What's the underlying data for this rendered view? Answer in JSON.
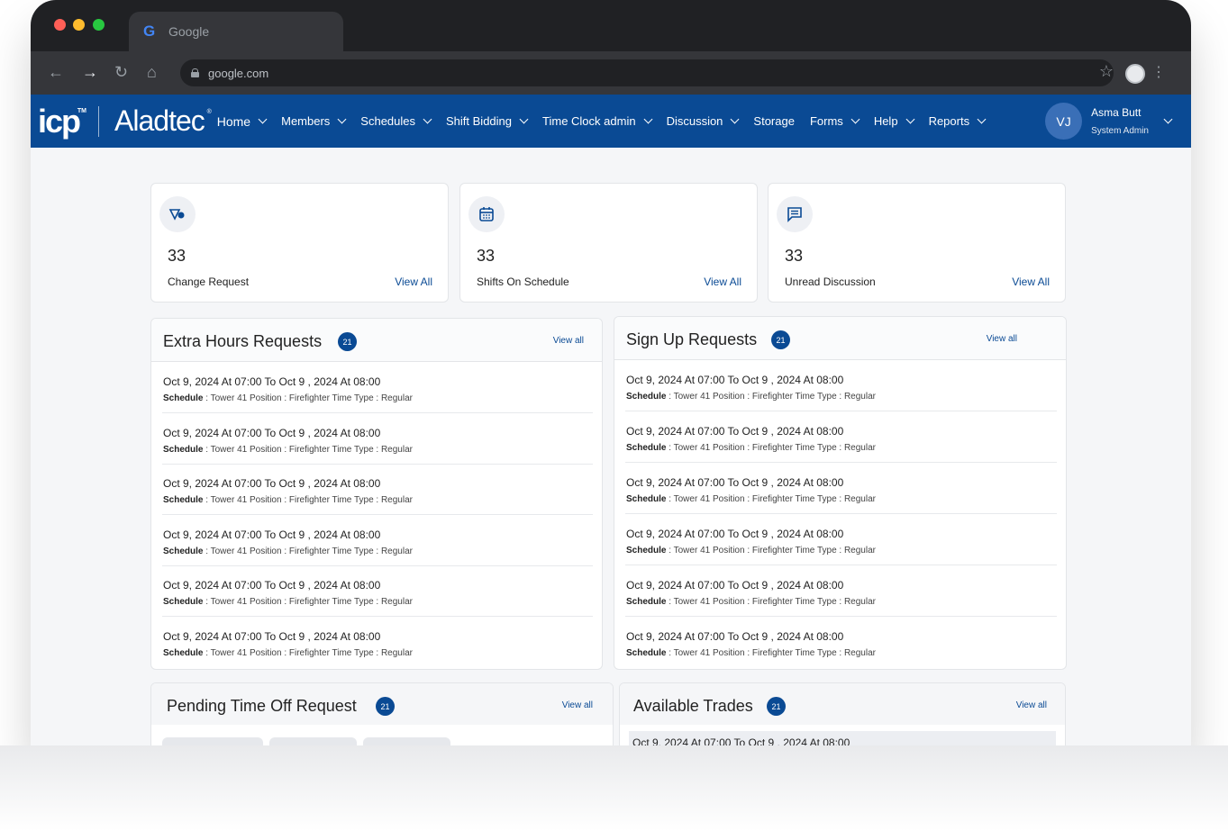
{
  "browser": {
    "tab_title": "Google",
    "url": "google.com"
  },
  "app": {
    "logo_icp": "icp",
    "logo_tm": "TM",
    "logo_aladtec": "Aladtec",
    "logo_reg": "®",
    "menu": [
      "Home",
      "Members",
      "Schedules",
      "Shift Bidding",
      "Time Clock admin",
      "Discussion",
      "Storage",
      "Forms",
      "Help",
      "Reports"
    ],
    "user": {
      "initials": "VJ",
      "name": "Asma Butt",
      "role": "System Admin"
    },
    "colors": {
      "brand": "#0a4a94"
    }
  },
  "stats": [
    {
      "icon": "tag-icon",
      "value": "33",
      "label": "Change Request",
      "link": "View All"
    },
    {
      "icon": "calendar-icon",
      "value": "33",
      "label": "Shifts On Schedule",
      "link": "View All"
    },
    {
      "icon": "message-icon",
      "value": "33",
      "label": "Unread Discussion",
      "link": "View All"
    }
  ],
  "extra_hours": {
    "title": "Extra Hours Requests",
    "count": "21",
    "link": "View all",
    "rows": [
      {
        "title": "Oct 9, 2024 At 07:00 To Oct 9 , 2024 At 08:00",
        "schedule_label": "Schedule",
        "detail": " : Tower 41  Position : Firefighter  Time Type  : Regular"
      },
      {
        "title": "Oct 9, 2024 At 07:00 To Oct 9 , 2024 At 08:00",
        "schedule_label": "Schedule",
        "detail": " : Tower 41  Position : Firefighter  Time Type  : Regular"
      },
      {
        "title": "Oct 9, 2024 At 07:00 To Oct 9 , 2024 At 08:00",
        "schedule_label": "Schedule",
        "detail": " : Tower 41  Position : Firefighter  Time Type  : Regular"
      },
      {
        "title": "Oct 9, 2024 At 07:00 To Oct 9 , 2024 At 08:00",
        "schedule_label": "Schedule",
        "detail": " : Tower 41  Position : Firefighter  Time Type  : Regular"
      },
      {
        "title": "Oct 9, 2024 At 07:00 To Oct 9 , 2024 At 08:00",
        "schedule_label": "Schedule",
        "detail": " : Tower 41  Position : Firefighter  Time Type  : Regular"
      },
      {
        "title": "Oct 9, 2024 At 07:00 To Oct 9 , 2024 At 08:00",
        "schedule_label": "Schedule",
        "detail": " : Tower 41  Position : Firefighter  Time Type  : Regular"
      }
    ]
  },
  "signup": {
    "title": "Sign Up Requests",
    "count": "21",
    "link": "View all",
    "rows": [
      {
        "title": "Oct 9, 2024 At 07:00 To Oct 9 , 2024 At 08:00",
        "schedule_label": "Schedule",
        "detail": " : Tower 41  Position : Firefighter  Time Type  : Regular"
      },
      {
        "title": "Oct 9, 2024 At 07:00 To Oct 9 , 2024 At 08:00",
        "schedule_label": "Schedule",
        "detail": " : Tower 41  Position : Firefighter  Time Type  : Regular"
      },
      {
        "title": "Oct 9, 2024 At 07:00 To Oct 9 , 2024 At 08:00",
        "schedule_label": "Schedule",
        "detail": " : Tower 41  Position : Firefighter  Time Type  : Regular"
      },
      {
        "title": "Oct 9, 2024 At 07:00 To Oct 9 , 2024 At 08:00",
        "schedule_label": "Schedule",
        "detail": " : Tower 41  Position : Firefighter  Time Type  : Regular"
      },
      {
        "title": "Oct 9, 2024 At 07:00 To Oct 9 , 2024 At 08:00",
        "schedule_label": "Schedule",
        "detail": " : Tower 41  Position : Firefighter  Time Type  : Regular"
      },
      {
        "title": "Oct 9, 2024 At 07:00 To Oct 9 , 2024 At 08:00",
        "schedule_label": "Schedule",
        "detail": " : Tower 41  Position : Firefighter  Time Type  : Regular"
      }
    ]
  },
  "pending_time_off": {
    "title": "Pending Time Off Request",
    "count": "21",
    "link": "View all"
  },
  "available_trades": {
    "title": "Available Trades",
    "count": "21",
    "link": "View all",
    "peek_text": "Oct 9, 2024 At 07:00 To Oct 9 , 2024 At 08:00"
  }
}
